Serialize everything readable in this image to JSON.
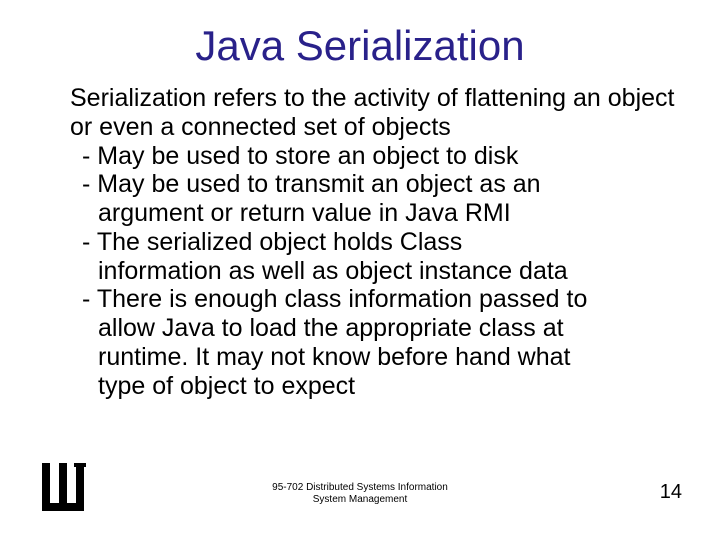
{
  "title": "Java Serialization",
  "intro": "Serialization refers to the activity of flattening an object or even a connected set of objects",
  "b1": "- May be used to store an object to disk",
  "b2": "- May be used to transmit an object as an",
  "b2c": "argument or return value in Java RMI",
  "b3": "- The serialized object holds Class",
  "b3c": "information as well as object instance data",
  "b4": "- There is enough class information passed to",
  "b4c1": "allow Java to load the appropriate class at",
  "b4c2": "runtime. It may not know before hand what",
  "b4c3": "type of object to expect",
  "footer1": "95-702 Distributed Systems Information",
  "footer2": "System Management",
  "page": "14"
}
